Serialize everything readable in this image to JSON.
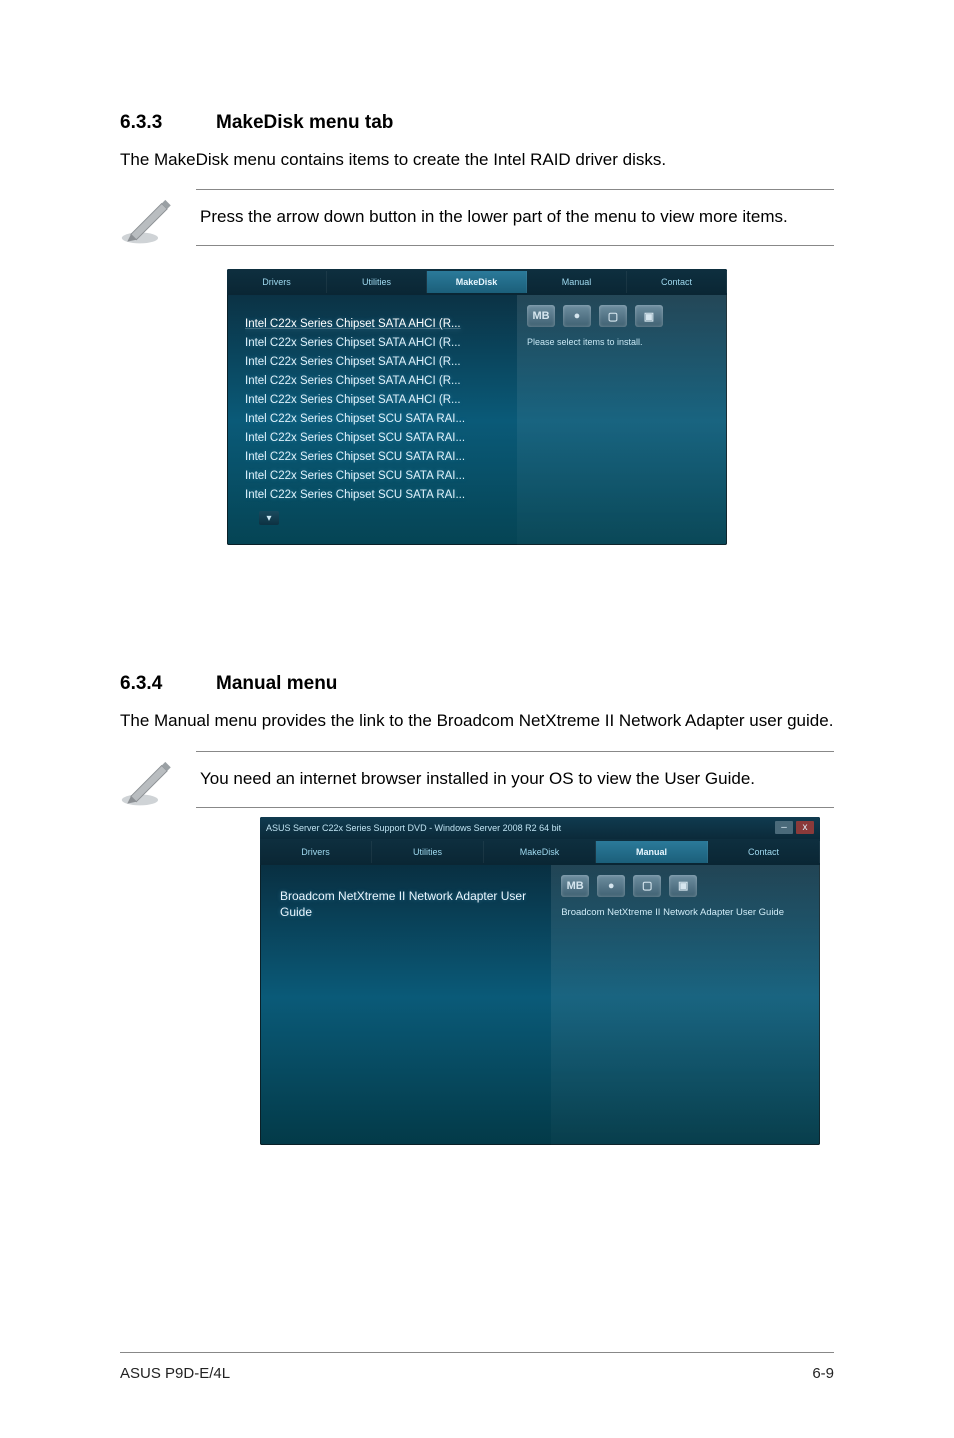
{
  "section1": {
    "number": "6.3.3",
    "title": "MakeDisk menu tab",
    "intro": "The MakeDisk menu contains items to create the Intel RAID driver disks.",
    "note": "Press the arrow down button in the lower part of the menu to view more items."
  },
  "makedisk_app": {
    "tabs": [
      "Drivers",
      "Utilities",
      "MakeDisk",
      "Manual",
      "Contact"
    ],
    "active_tab_index": 2,
    "badges": [
      "MB",
      "●",
      "▢",
      "▣"
    ],
    "side_hint": "Please select items to install.",
    "items": [
      "Intel C22x Series Chipset SATA AHCI (R...",
      "Intel C22x Series Chipset SATA AHCI (R...",
      "Intel C22x Series Chipset SATA AHCI (R...",
      "Intel C22x Series Chipset SATA AHCI (R...",
      "Intel C22x Series Chipset SATA AHCI (R...",
      "Intel C22x Series Chipset SCU SATA RAI...",
      "Intel C22x Series Chipset SCU SATA RAI...",
      "Intel C22x Series Chipset SCU SATA RAI...",
      "Intel C22x Series Chipset SCU SATA RAI...",
      "Intel C22x Series Chipset SCU SATA RAI..."
    ],
    "arrow_glyph": "▾"
  },
  "section2": {
    "number": "6.3.4",
    "title": "Manual menu",
    "intro": "The Manual menu provides the link to the Broadcom NetXtreme II Network Adapter user guide.",
    "note": "You need an internet browser installed in your OS to view the User Guide."
  },
  "manual_app": {
    "window_title": "ASUS Server C22x Series Support DVD - Windows Server 2008 R2 64 bit",
    "tabs": [
      "Drivers",
      "Utilities",
      "MakeDisk",
      "Manual",
      "Contact"
    ],
    "active_tab_index": 3,
    "badges": [
      "MB",
      "●",
      "▢",
      "▣"
    ],
    "left_item": "Broadcom NetXtreme II Network Adapter User Guide",
    "right_item": "Broadcom NetXtreme II Network Adapter User Guide"
  },
  "footer": {
    "left": "ASUS P9D-E/4L",
    "right": "6-9"
  }
}
